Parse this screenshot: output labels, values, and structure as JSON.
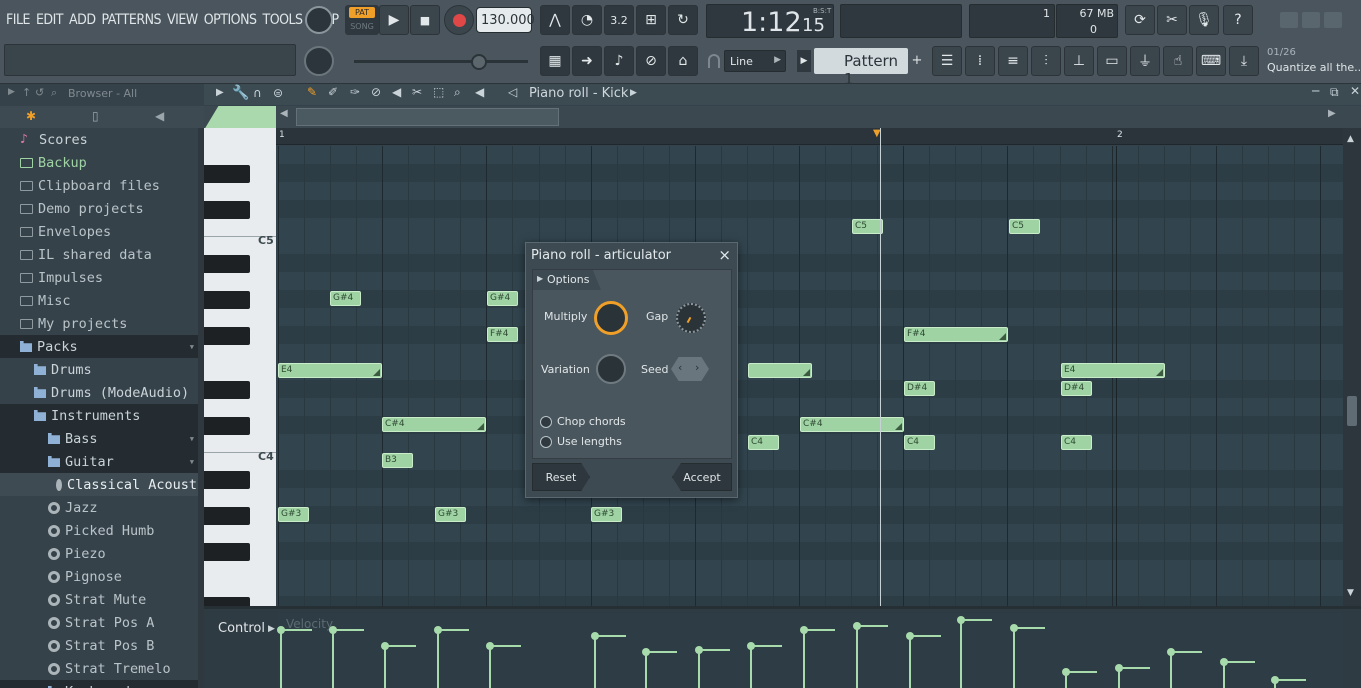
{
  "menu": [
    "FILE",
    "EDIT",
    "ADD",
    "PATTERNS",
    "VIEW",
    "OPTIONS",
    "TOOLS",
    "HELP"
  ],
  "transport": {
    "pat_label": "PAT",
    "song_label": "SONG",
    "tempo": "130.000",
    "time_main": "1:12",
    "time_small": "15",
    "time_format": "B:S:T"
  },
  "meters": {
    "cpu_value": "1",
    "memory": "67 MB",
    "polyphony": "0"
  },
  "toolbar2": {
    "snap_mode": "Line",
    "pattern_name": "Pattern 1",
    "hint_counter": "01/26",
    "hint_text": "Quantize all the..."
  },
  "browser": {
    "header": "Browser - All",
    "items": [
      {
        "label": "Scores",
        "type": "score"
      },
      {
        "label": "Backup",
        "type": "folder-backup"
      },
      {
        "label": "Clipboard files",
        "type": "folder"
      },
      {
        "label": "Demo projects",
        "type": "folder"
      },
      {
        "label": "Envelopes",
        "type": "folder"
      },
      {
        "label": "IL shared data",
        "type": "folder"
      },
      {
        "label": "Impulses",
        "type": "folder"
      },
      {
        "label": "Misc",
        "type": "folder"
      },
      {
        "label": "My projects",
        "type": "folder"
      },
      {
        "label": "Packs",
        "type": "pack"
      },
      {
        "label": "Drums",
        "type": "pack"
      },
      {
        "label": "Drums (ModeAudio)",
        "type": "pack"
      },
      {
        "label": "Instruments",
        "type": "pack"
      },
      {
        "label": "Bass",
        "type": "pack"
      },
      {
        "label": "Guitar",
        "type": "pack"
      },
      {
        "label": "Classical Acoustic",
        "type": "preset"
      },
      {
        "label": "Jazz",
        "type": "preset"
      },
      {
        "label": "Picked Humb",
        "type": "preset"
      },
      {
        "label": "Piezo",
        "type": "preset"
      },
      {
        "label": "Pignose",
        "type": "preset"
      },
      {
        "label": "Strat Mute",
        "type": "preset"
      },
      {
        "label": "Strat Pos A",
        "type": "preset"
      },
      {
        "label": "Strat Pos B",
        "type": "preset"
      },
      {
        "label": "Strat Tremelo",
        "type": "preset"
      },
      {
        "label": "Keyboard",
        "type": "pack"
      }
    ]
  },
  "piano_roll": {
    "title": "Piano roll - Kick",
    "bar_markers": [
      "1",
      "2"
    ],
    "key_labels": [
      "C5",
      "C4"
    ],
    "control_label": "Control",
    "control_target": "Velocity",
    "notes": [
      {
        "label": "C5",
        "pitch": "C5",
        "step": 33
      },
      {
        "label": "C5",
        "pitch": "C5",
        "step": 42
      },
      {
        "label": "G#4",
        "pitch": "G#4",
        "step": 3
      },
      {
        "label": "G#4",
        "pitch": "G#4",
        "step": 12
      },
      {
        "label": "F#4",
        "pitch": "F#4",
        "step": 12
      },
      {
        "label": "F#4",
        "pitch": "F#4",
        "step": 36
      },
      {
        "label": "E4",
        "pitch": "E4",
        "step": 0
      },
      {
        "label": "",
        "pitch": "E4",
        "step": 27
      },
      {
        "label": "E4",
        "pitch": "E4",
        "step": 45
      },
      {
        "label": "D#4",
        "pitch": "D#4",
        "step": 36
      },
      {
        "label": "D#4",
        "pitch": "D#4",
        "step": 45
      },
      {
        "label": "C#4",
        "pitch": "C#4",
        "step": 6
      },
      {
        "label": "C#4",
        "pitch": "C#4",
        "step": 30
      },
      {
        "label": "C4",
        "pitch": "C4",
        "step": 27
      },
      {
        "label": "C4",
        "pitch": "C4",
        "step": 36
      },
      {
        "label": "C4",
        "pitch": "C4",
        "step": 45
      },
      {
        "label": "B3",
        "pitch": "B3",
        "step": 6
      },
      {
        "label": "G#3",
        "pitch": "G#3",
        "step": 0
      },
      {
        "label": "G#3",
        "pitch": "G#3",
        "step": 9
      },
      {
        "label": "G#3",
        "pitch": "G#3",
        "step": 18
      }
    ]
  },
  "dialog": {
    "title": "Piano roll - articulator",
    "close": "×",
    "options_label": "Options",
    "multiply_label": "Multiply",
    "gap_label": "Gap",
    "variation_label": "Variation",
    "seed_label": "Seed",
    "chop_chords_label": "Chop chords",
    "use_lengths_label": "Use lengths",
    "reset_label": "Reset",
    "accept_label": "Accept"
  },
  "colors": {
    "note_fill": "#9fd3a4",
    "accent_orange": "#f0a028",
    "record_red": "#e04848"
  }
}
